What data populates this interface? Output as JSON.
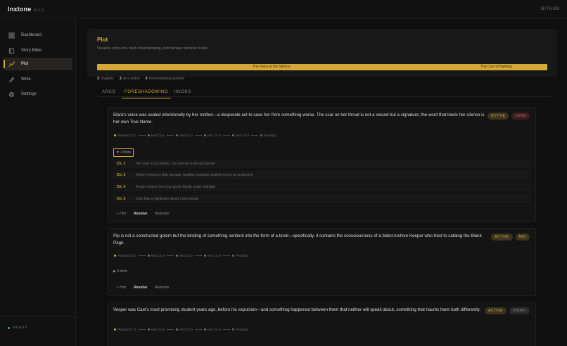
{
  "app": {
    "title": "Inxtone",
    "version": "v0.1.0",
    "github_label": "GITHUB"
  },
  "sidebar": {
    "items": [
      {
        "label": "Dashboard",
        "icon": "grid-icon"
      },
      {
        "label": "Story Bible",
        "icon": "book-icon"
      },
      {
        "label": "Plot",
        "icon": "plot-icon",
        "active": true
      },
      {
        "label": "Write",
        "icon": "pen-icon"
      },
      {
        "label": "Settings",
        "icon": "gear-icon"
      }
    ],
    "status": "READY"
  },
  "header": {
    "title": "Plot",
    "subtitle": "Visualize story arcs, track foreshadowing, and manage narrative hooks",
    "arcs": [
      "The Voice in the Silence",
      "The Cost of Naming"
    ]
  },
  "stats": [
    {
      "count": "3",
      "label": "chapters"
    },
    {
      "count": "2",
      "label": "arcs active"
    },
    {
      "count": "3",
      "label": "foreshadowing planted"
    }
  ],
  "tabs": [
    {
      "label": "ARCS"
    },
    {
      "label": "FORESHADOWING",
      "active": true
    },
    {
      "label": "HOOKS"
    }
  ],
  "cards": [
    {
      "text": "Elara's voice was sealed intentionally by her mother—a desperate act to save her from something worse. The scar on her throat is not a wound but a signature; the word that binds her silence is her own True Name.",
      "badges": [
        "ACTIVE",
        "LONG"
      ],
      "timeline": [
        "Planted Ch.1",
        "Hint Ch.1",
        "Hint Ch.2",
        "Hint Ch.4",
        "Hint Ch.5",
        "Pending"
      ],
      "hints_toggle": "▼ 4 hints",
      "hints": [
        {
          "ch": "Ch. 1",
          "text": "Her scar is too perfect, too precise to be accidental"
        },
        {
          "ch": "Ch. 2",
          "text": "Maren mentions that nomadic tradition includes sealed voices as protection"
        },
        {
          "ch": "Ch. 4",
          "text": "A tutor notices her scar glows faintly under starlight"
        },
        {
          "ch": "Ch. 5",
          "text": "Cael has a nightmare about Lira's throat"
        }
      ],
      "actions": [
        "+ Hint",
        "Resolve",
        "Abandon"
      ]
    },
    {
      "text": "Pip is not a constructed golem but the binding of something sentient into the form of a book—specifically, it contains the consciousness of a failed Archive Keeper who tried to catalog the Blank Page.",
      "badges": [
        "ACTIVE",
        "MID"
      ],
      "timeline": [
        "Planted Ch.2",
        "Hint Ch.3",
        "Hint Ch.5",
        "Hint Ch.6",
        "Pending"
      ],
      "hints_toggle": "▶ 3 hints",
      "actions": [
        "+ Hint",
        "Resolve",
        "Abandon"
      ]
    },
    {
      "text": "Vesper was Cael's most promising student years ago, before his expulsion—and something happened between them that neither will speak about, something that haunts them both differently.",
      "badges": [
        "ACTIVE",
        "SHORT"
      ],
      "timeline": [
        "Planted Ch.3",
        "Hint Ch.3",
        "Hint Ch.5",
        "Hint Ch.6",
        "Pending"
      ]
    }
  ],
  "colors": {
    "accent": "#d4a937",
    "background": "#0f0f0f",
    "long_badge": "#d86a6a",
    "ready": "#3fae6b"
  }
}
